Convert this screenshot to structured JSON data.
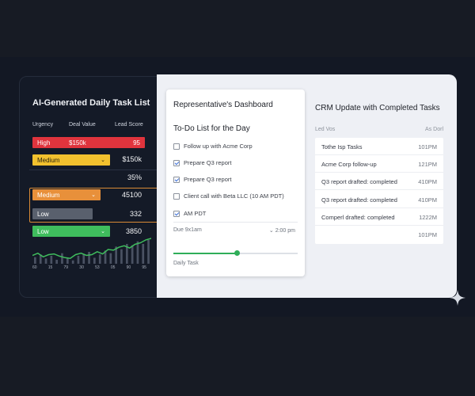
{
  "left": {
    "title": "AI-Generated Daily Task List",
    "headers": [
      "Urgency",
      "Deal Value",
      "Lead Score"
    ],
    "rows": [
      {
        "label": "High",
        "deal": "$150k",
        "score": "95"
      },
      {
        "label": "Medium",
        "side": "$150k"
      },
      {
        "side": "35%"
      },
      {
        "label": "Medium",
        "side": "45100"
      },
      {
        "label": "Low",
        "side": "332"
      },
      {
        "label": "Low",
        "side": "3850"
      }
    ],
    "sparkline": [
      7,
      10,
      5,
      8,
      9,
      6,
      4,
      3,
      8,
      10,
      7,
      8,
      12,
      9,
      15,
      14,
      18,
      20,
      17,
      22,
      24,
      28,
      30
    ],
    "bars": [
      10,
      14,
      8,
      12,
      6,
      16,
      9,
      5,
      12,
      15,
      18,
      9,
      14,
      20,
      16,
      26,
      22,
      30,
      28,
      34,
      30,
      36
    ],
    "ticks": [
      "60",
      "15",
      "79",
      "30",
      "53",
      "05",
      "90",
      "95"
    ]
  },
  "dashboard": {
    "title": "Representative's Dashboard",
    "subtitle": "To-Do List for the Day",
    "tasks": [
      {
        "label": "Follow up with Acme Corp",
        "checked": false
      },
      {
        "label": "Prepare Q3 report",
        "checked": true
      },
      {
        "label": "Prepare Q3 report",
        "checked": true
      },
      {
        "label": "Client call with Beta LLC (10 AM PDT)",
        "checked": false
      },
      {
        "label": "AM PDT",
        "checked": true
      }
    ],
    "due_label": "Due 9x1am",
    "due_time": "2:00 pm",
    "progress_label": "Daily Task",
    "progress": 0.51
  },
  "crm": {
    "title": "CRM Update with Completed Tasks",
    "header_left": "Led Vos",
    "header_right": "As Dorl",
    "rows": [
      {
        "name": "Tothe Isp Tasks",
        "time": "101PM"
      },
      {
        "name": "Acme Corp follow-up",
        "time": "121PM"
      },
      {
        "name": "Q3 report drafted: completed",
        "time": "410PM"
      },
      {
        "name": "Q3 report drafted: completed",
        "time": "410PM"
      },
      {
        "name": "Comperl drafted: completed",
        "time": "1222M"
      },
      {
        "name": "",
        "time": "101PM"
      }
    ]
  },
  "colors": {
    "high": "#e0343d",
    "medium": "#f2c12e",
    "orange": "#e8903a",
    "low_gray": "#59606d",
    "low_green": "#3fbd5d",
    "accent_green": "#2fae59"
  }
}
